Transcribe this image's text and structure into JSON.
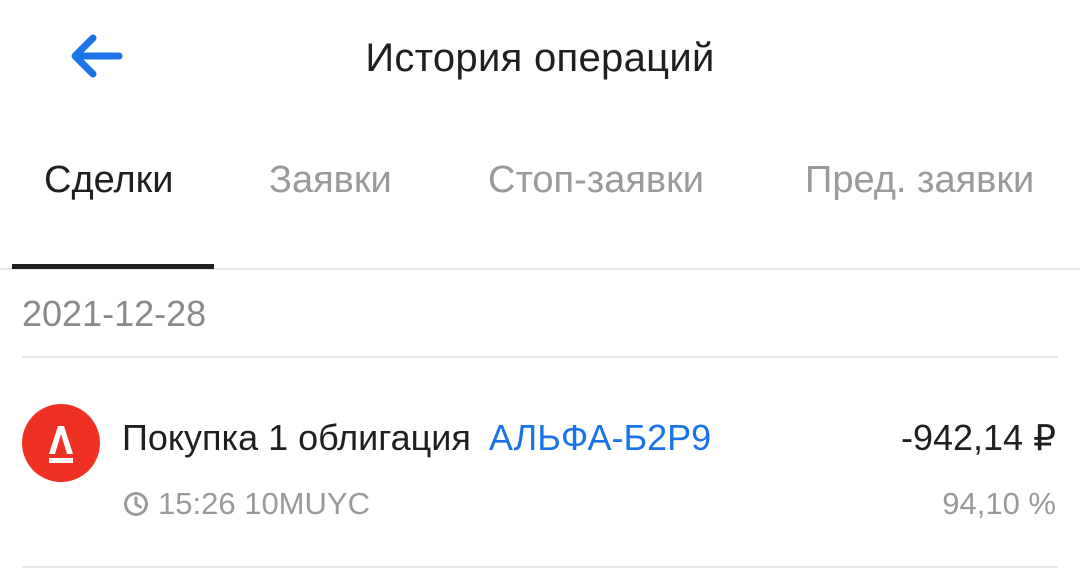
{
  "header": {
    "title": "История операций",
    "back_icon": "arrow-left-icon",
    "accent_color": "#1a73e8"
  },
  "tabs": [
    {
      "label": "Сделки",
      "active": true
    },
    {
      "label": "Заявки",
      "active": false
    },
    {
      "label": "Стоп-заявки",
      "active": false
    },
    {
      "label": "Пред. заявки",
      "active": false
    }
  ],
  "groups": [
    {
      "date": "2021-12-28",
      "operations": [
        {
          "logo_icon": "alfa-bank-logo-icon",
          "logo_letter": "А",
          "logo_color": "#ef3124",
          "description": "Покупка 1 облигация",
          "ticker": "АЛЬФА-Б2Р9",
          "amount": "-942,14 ₽",
          "time_icon": "clock-icon",
          "time": "15:26",
          "account": "10MUYC",
          "percent": "94,10 %"
        }
      ]
    }
  ]
}
